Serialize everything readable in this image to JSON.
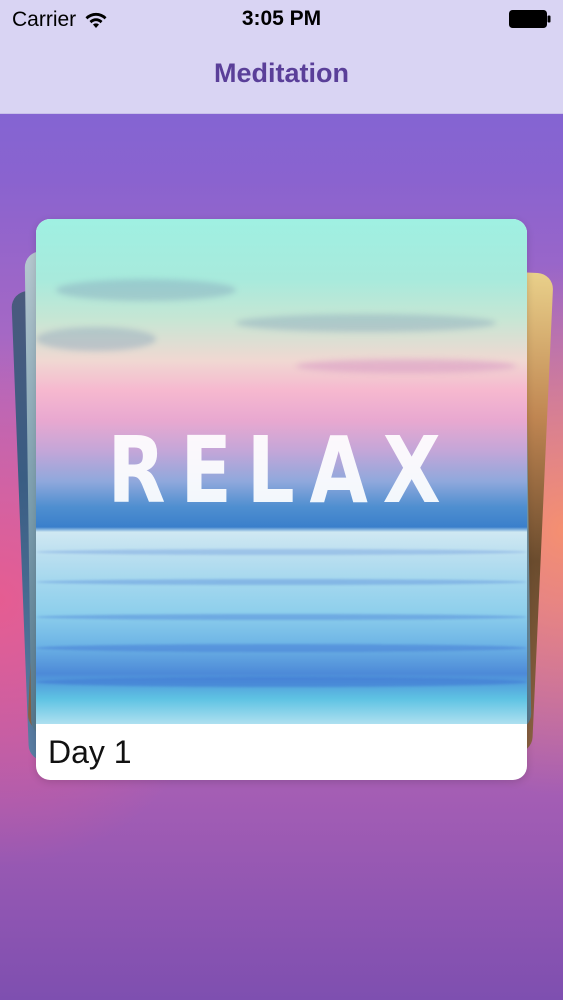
{
  "status_bar": {
    "carrier": "Carrier",
    "time": "3:05 PM",
    "wifi_icon": "wifi-icon",
    "battery_icon": "battery-full-icon"
  },
  "nav": {
    "title": "Meditation"
  },
  "cards": [
    {
      "image_text": "RELAX",
      "label": "Day 1"
    }
  ],
  "colors": {
    "nav_background": "#d9d4f3",
    "nav_title": "#5a3f99",
    "background_top": "#7a66d8",
    "background_bottom": "#7e4fb0"
  }
}
